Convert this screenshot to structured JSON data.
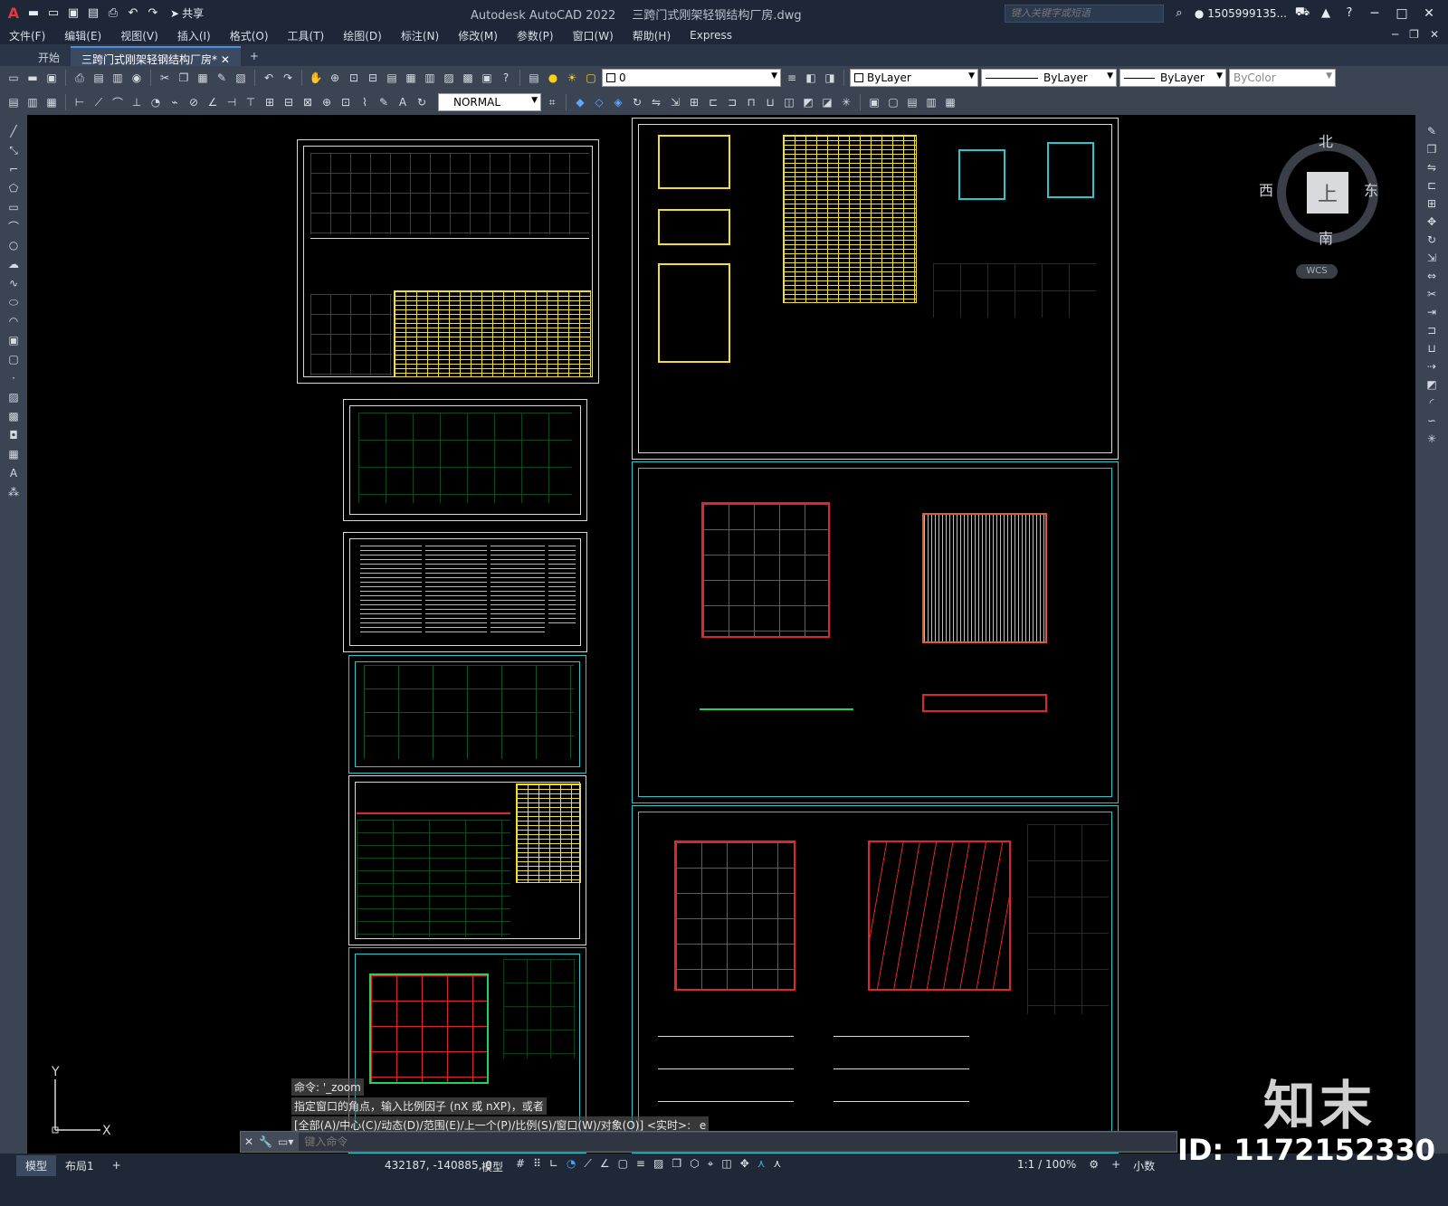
{
  "app": {
    "name": "Autodesk AutoCAD 2022",
    "file": "三跨门式刚架轻钢结构厂房.dwg"
  },
  "quick_access": {
    "share_label": "共享"
  },
  "search": {
    "placeholder": "键入关键字或短语"
  },
  "user": {
    "name": "1505999135..."
  },
  "menu": {
    "items": [
      "文件(F)",
      "编辑(E)",
      "视图(V)",
      "插入(I)",
      "格式(O)",
      "工具(T)",
      "绘图(D)",
      "标注(N)",
      "修改(M)",
      "参数(P)",
      "窗口(W)",
      "帮助(H)",
      "Express"
    ]
  },
  "tabs": [
    {
      "label": "开始"
    },
    {
      "label": "三跨门式刚架轻钢结构厂房*"
    }
  ],
  "toolbar": {
    "layer_value": "0",
    "color_value": "ByLayer",
    "linetype_value": "ByLayer",
    "lineweight_value": "ByLayer",
    "plotstyle_value": "ByColor",
    "dimstyle_value": "NORMAL"
  },
  "viewcube": {
    "north": "北",
    "south": "南",
    "east": "东",
    "west": "西",
    "face": "上",
    "wcs": "WCS"
  },
  "command": {
    "history": [
      "命令: '_zoom",
      "指定窗口的角点，输入比例因子 (nX 或 nXP)，或者",
      "[全部(A)/中心(C)/动态(D)/范围(E)/上一个(P)/比例(S)/窗口(W)/对象(O)] <实时>: _e"
    ],
    "placeholder": "键入命令"
  },
  "status": {
    "tabs": [
      "模型",
      "布局1"
    ],
    "coords": "432187, -140885, 0",
    "model_label": "模型",
    "scale": "1:1 / 100%",
    "units": "小数"
  },
  "watermark": {
    "brand": "知末",
    "id": "ID: 1172152330"
  },
  "colors": {
    "cyan": "#27c9cf",
    "yellow": "#f3e11a",
    "green": "#1fd45e",
    "red": "#e0262b"
  }
}
